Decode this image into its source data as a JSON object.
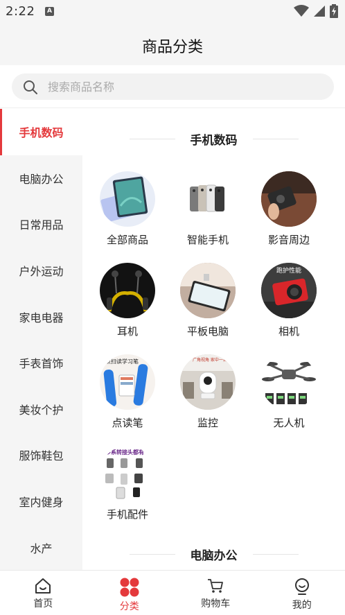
{
  "status": {
    "time": "2:22",
    "badge": "A"
  },
  "header": {
    "title": "商品分类"
  },
  "search": {
    "placeholder": "搜索商品名称"
  },
  "sidebar": {
    "items": [
      {
        "label": "手机数码",
        "active": true
      },
      {
        "label": "电脑办公"
      },
      {
        "label": "日常用品"
      },
      {
        "label": "户外运动"
      },
      {
        "label": "家电电器"
      },
      {
        "label": "手表首饰"
      },
      {
        "label": "美妆个护"
      },
      {
        "label": "服饰鞋包"
      },
      {
        "label": "室内健身"
      },
      {
        "label": "水产"
      }
    ]
  },
  "content": {
    "section1_title": "手机数码",
    "section2_title": "电脑办公",
    "items": [
      {
        "label": "全部商品",
        "icon": "tablet-image"
      },
      {
        "label": "智能手机",
        "icon": "smartphones-image"
      },
      {
        "label": "影音周边",
        "icon": "audio-device-image"
      },
      {
        "label": "耳机",
        "icon": "earphones-image"
      },
      {
        "label": "平板电脑",
        "icon": "tablet-pc-image"
      },
      {
        "label": "相机",
        "icon": "camera-image"
      },
      {
        "label": "点读笔",
        "icon": "reading-pen-image"
      },
      {
        "label": "监控",
        "icon": "security-camera-image"
      },
      {
        "label": "无人机",
        "icon": "drone-image"
      },
      {
        "label": "手机配件",
        "icon": "phone-accessories-image"
      }
    ],
    "promo_texts": {
      "pen": "点扫读学习笔",
      "camera_cap": "跑护性能",
      "monitor": "广角视角\n家中一目了然",
      "accessory": "多系转接头都有"
    }
  },
  "tabbar": {
    "items": [
      {
        "label": "首页"
      },
      {
        "label": "分类",
        "active": true
      },
      {
        "label": "购物车"
      },
      {
        "label": "我的"
      }
    ]
  },
  "colors": {
    "accent": "#e4393c",
    "sidebar_bg": "#f5f5f5"
  }
}
